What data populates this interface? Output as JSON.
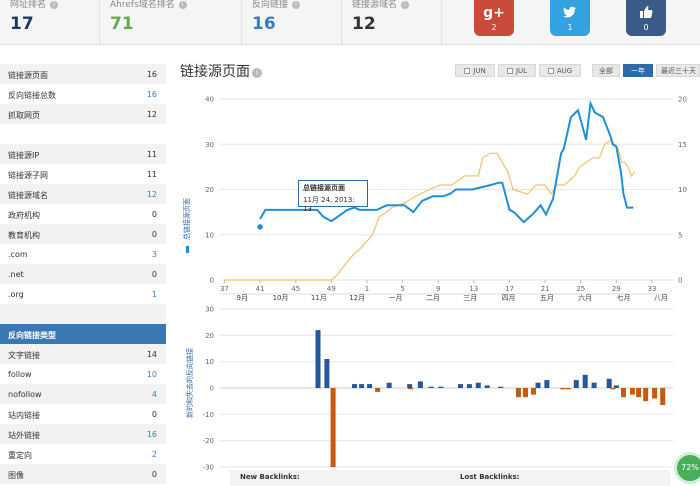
{
  "metrics": [
    {
      "label": "网址排名",
      "value": "17",
      "color": "#1e3a5f"
    },
    {
      "label": "Ahrefs域名排名",
      "value": "71",
      "color": "#6aa84f"
    },
    {
      "label": "反向链接",
      "value": "16",
      "color": "#3a7ec2"
    },
    {
      "label": "链接源域名",
      "value": "12",
      "color": "#333333"
    }
  ],
  "social": [
    {
      "name": "google-plus",
      "glyph": "g+",
      "count": "2",
      "color": "#c94a3b"
    },
    {
      "name": "twitter",
      "glyph": "t",
      "count": "1",
      "color": "#33a2e0"
    },
    {
      "name": "like",
      "glyph": "👍",
      "count": "0",
      "color": "#3a5a88"
    }
  ],
  "sidebar": {
    "group1": [
      {
        "label": "链接源页面",
        "value": "16",
        "link": false
      },
      {
        "label": "反向链接总数",
        "value": "16",
        "link": true
      },
      {
        "label": "抓取网页",
        "value": "12",
        "link": false
      }
    ],
    "group2": [
      {
        "label": "链接源IP",
        "value": "11",
        "link": false
      },
      {
        "label": "链接源子网",
        "value": "11",
        "link": false
      },
      {
        "label": "链接源域名",
        "value": "12",
        "link": true
      },
      {
        "label": "政府机构",
        "value": "0",
        "link": false
      },
      {
        "label": "教育机构",
        "value": "0",
        "link": false
      },
      {
        "label": ".com",
        "value": "3",
        "link": true
      },
      {
        "label": ".net",
        "value": "0",
        "link": false
      },
      {
        "label": ".org",
        "value": "1",
        "link": true
      }
    ],
    "section_title": "反向链接类型",
    "group3": [
      {
        "label": "文字链接",
        "value": "14",
        "link": false
      },
      {
        "label": "follow",
        "value": "10",
        "link": true
      },
      {
        "label": "nofollow",
        "value": "4",
        "link": true
      },
      {
        "label": "站内链接",
        "value": "0",
        "link": false
      },
      {
        "label": "站外链接",
        "value": "16",
        "link": true
      },
      {
        "label": "重定向",
        "value": "2",
        "link": true
      },
      {
        "label": "图像",
        "value": "0",
        "link": false
      }
    ]
  },
  "chart_title": "链接源页面",
  "range_buttons": [
    {
      "label": "JUN",
      "checkbox": true,
      "active": false
    },
    {
      "label": "JUL",
      "checkbox": true,
      "active": false
    },
    {
      "label": "AUG",
      "checkbox": true,
      "active": false
    },
    {
      "label": "全部",
      "checkbox": false,
      "active": false
    },
    {
      "label": "一年",
      "checkbox": false,
      "active": true
    },
    {
      "label": "最近三十天",
      "checkbox": false,
      "active": false
    }
  ],
  "tooltip": {
    "title": "总链接源页面",
    "text": "11月 24, 2013: 13"
  },
  "legend_left": "总链接源页面",
  "legend_bottom": "新的和失去的反向链接",
  "backlinks_new": "New Backlinks:",
  "backlinks_lost": "Lost Backlinks:",
  "badge": "72%",
  "colors": {
    "blue": "#1f8fd8",
    "orange": "#f5c06a",
    "bar_blue": "#24589b",
    "bar_orange": "#c55a11"
  },
  "chart_data": [
    {
      "type": "line",
      "ylim_left": [
        0,
        40
      ],
      "ylim_right": [
        0,
        20
      ],
      "left_ticks": [
        "0",
        "10",
        "20",
        "30",
        "40"
      ],
      "right_ticks": [
        "0",
        "5",
        "10",
        "15",
        "20"
      ],
      "week_ticks": [
        "37",
        "41",
        "45",
        "49",
        "1",
        "5",
        "9",
        "13",
        "17",
        "21",
        "25",
        "29",
        "33"
      ],
      "month_ticks": [
        "9月",
        "10月",
        "11月",
        "12月",
        "一月",
        "二月",
        "三月",
        "四月",
        "五月",
        "六月",
        "七月",
        "八月"
      ],
      "series": [
        {
          "name": "总链接源页面",
          "axis": "left",
          "x": [
            41.0,
            41.6,
            42.5,
            47.4,
            48.1,
            49.0,
            50.8,
            51.6,
            52.2,
            52.8,
            54.1,
            55.2,
            57.2,
            58.2,
            59.2,
            60.4,
            61.5,
            62.3,
            63.0,
            64.8,
            66.9,
            67.8,
            68.2,
            69.0,
            69.5,
            70.6,
            71.6,
            72.5,
            73.1,
            73.9,
            74.8,
            75.1,
            75.9,
            76.7,
            77.6,
            78.1,
            78.6,
            79.5,
            80.3,
            80.6,
            81.0,
            81.5,
            81.8,
            82.2,
            82.9
          ],
          "values": [
            13.5,
            15.5,
            15.5,
            15.5,
            14.0,
            13.0,
            15.5,
            16.0,
            15.5,
            15.5,
            15.5,
            16.5,
            16.5,
            15.0,
            17.5,
            18.5,
            18.5,
            19.0,
            20.0,
            20.0,
            21.0,
            21.5,
            21.5,
            15.5,
            15.0,
            12.8,
            14.5,
            16.5,
            14.5,
            18.0,
            28.0,
            29.0,
            36.0,
            37.5,
            31.0,
            39.0,
            37.0,
            36.0,
            32.0,
            30.0,
            29.5,
            24.0,
            19.0,
            16.0,
            16.0
          ]
        },
        {
          "name": "",
          "axis": "right",
          "x": [
            37.0,
            39.0,
            42.0,
            45.0,
            47.0,
            49.0,
            49.6,
            50.0,
            50.4,
            50.8,
            51.2,
            51.7,
            52.3,
            52.7,
            53.2,
            53.6,
            54.0,
            54.4,
            55.2,
            55.8,
            57.2,
            58.0,
            59.0,
            60.0,
            61.2,
            62.5,
            64.0,
            65.5,
            66.0,
            66.8,
            67.6,
            68.2,
            68.8,
            69.4,
            71.0,
            72.0,
            73.0,
            73.7,
            74.3,
            75.2,
            76.3,
            76.9,
            77.6,
            78.4,
            79.1,
            79.7,
            80.4,
            80.8,
            81.2,
            81.6,
            81.9,
            82.3,
            82.7,
            83.1
          ],
          "values": [
            0,
            0,
            0,
            0,
            0,
            0,
            0.5,
            1.0,
            1.5,
            2.0,
            2.5,
            3.0,
            3.5,
            4.0,
            4.5,
            5.0,
            6.0,
            7.0,
            7.5,
            8.0,
            8.5,
            9.0,
            9.5,
            10.0,
            10.5,
            10.5,
            11.5,
            11.5,
            13.5,
            14.0,
            14.0,
            13.0,
            12.0,
            10.0,
            9.5,
            10.5,
            10.5,
            9.5,
            10.5,
            10.5,
            11.5,
            12.5,
            13.0,
            13.5,
            13.5,
            15.0,
            15.5,
            15.0,
            14.5,
            13.0,
            13.0,
            12.5,
            11.5,
            12.0
          ]
        }
      ]
    },
    {
      "type": "bar",
      "ylim": [
        -30,
        30
      ],
      "ticks": [
        "30",
        "20",
        "10",
        "0",
        "-10",
        "-20",
        "-30"
      ],
      "series": [
        {
          "name": "",
          "x": [
            47.5,
            48.5,
            51.6,
            52.4,
            53.3,
            55.5,
            57.8,
            59.0,
            60.2,
            61.3,
            63.5,
            64.5,
            65.5,
            66.5,
            68.0,
            72.2,
            73.2,
            76.5,
            77.5,
            78.5,
            80.2,
            81.0
          ],
          "values": [
            22,
            11,
            1.5,
            1.5,
            1.5,
            2,
            1.5,
            2.5,
            0.5,
            0.5,
            1.5,
            1.5,
            2,
            1,
            0.5,
            2,
            3,
            3,
            5,
            2,
            3.5,
            1
          ]
        },
        {
          "name": "",
          "x": [
            49.2,
            54.2,
            57.9,
            70.0,
            70.8,
            71.7,
            75.0,
            75.6,
            80.6,
            81.8,
            82.8,
            83.5,
            84.3,
            85.3,
            86.2
          ],
          "values": [
            -30,
            -1.5,
            -0.5,
            -3.5,
            -3.5,
            -2.5,
            -0.5,
            -0.5,
            -0.5,
            -3.5,
            -2.5,
            -3.5,
            -5,
            -4,
            -6.5
          ]
        }
      ]
    }
  ]
}
